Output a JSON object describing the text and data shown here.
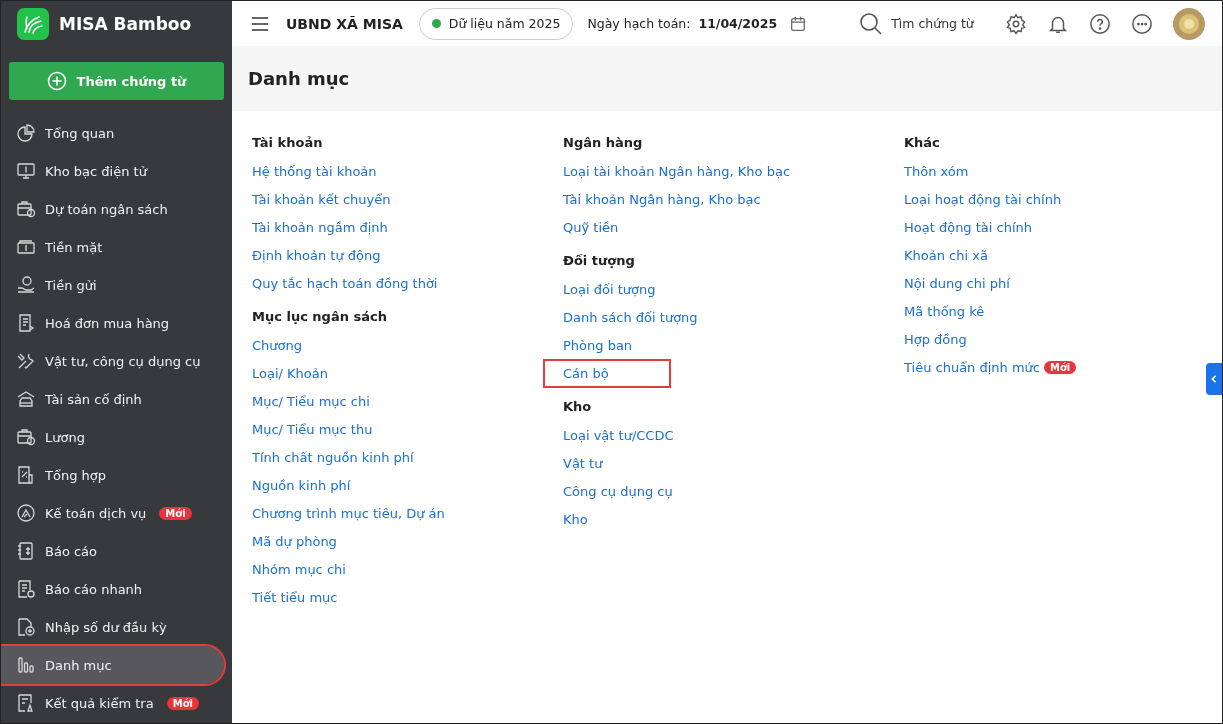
{
  "app": {
    "name": "MISA Bamboo",
    "add_button": "Thêm chứng từ"
  },
  "header": {
    "organization": "UBND XÃ MISA",
    "data_year": "Dữ liệu năm 2025",
    "posting_date_label": "Ngày hạch toán:",
    "posting_date": "11/04/2025",
    "search_placeholder": "Tìm chứng từ"
  },
  "sidebar": {
    "items": [
      {
        "label": "Tổng quan",
        "selected": false,
        "highlighted": false
      },
      {
        "label": "Kho bạc điện tử",
        "selected": false,
        "highlighted": false
      },
      {
        "label": "Dự toán ngân sách",
        "selected": false,
        "highlighted": false
      },
      {
        "label": "Tiền mặt",
        "selected": false,
        "highlighted": false
      },
      {
        "label": "Tiền gửi",
        "selected": false,
        "highlighted": false
      },
      {
        "label": "Hoá đơn mua hàng",
        "selected": false,
        "highlighted": false
      },
      {
        "label": "Vật tư, công cụ dụng cụ",
        "selected": false,
        "highlighted": false
      },
      {
        "label": "Tài sản cố định",
        "selected": false,
        "highlighted": false
      },
      {
        "label": "Lương",
        "selected": false,
        "highlighted": false
      },
      {
        "label": "Tổng hợp",
        "selected": false,
        "highlighted": false
      },
      {
        "label": "Kế toán dịch vụ",
        "selected": false,
        "highlighted": false,
        "badge": "Mới"
      },
      {
        "label": "Báo cáo",
        "selected": false,
        "highlighted": false
      },
      {
        "label": "Báo cáo nhanh",
        "selected": false,
        "highlighted": false
      },
      {
        "label": "Nhập số dư đầu kỳ",
        "selected": false,
        "highlighted": false
      },
      {
        "label": "Danh mục",
        "selected": true,
        "highlighted": true
      },
      {
        "label": "Kết quả kiểm tra",
        "selected": false,
        "highlighted": false,
        "badge": "Mới"
      }
    ]
  },
  "page": {
    "title": "Danh mục",
    "columns": [
      {
        "sections": [
          {
            "heading": "Tài khoản",
            "items": [
              {
                "label": "Hệ thống tài khoản",
                "highlighted": false
              },
              {
                "label": "Tài khoản kết chuyển",
                "highlighted": false
              },
              {
                "label": "Tài khoản ngầm định",
                "highlighted": false
              },
              {
                "label": "Định khoản tự động",
                "highlighted": false
              },
              {
                "label": "Quy tắc hạch toán đồng thời",
                "highlighted": false
              }
            ]
          },
          {
            "heading": "Mục lục ngân sách",
            "items": [
              {
                "label": "Chương",
                "highlighted": false
              },
              {
                "label": "Loại/ Khoản",
                "highlighted": false
              },
              {
                "label": "Mục/ Tiểu mục chi",
                "highlighted": false
              },
              {
                "label": "Mục/ Tiểu mục thu",
                "highlighted": false
              },
              {
                "label": "Tính chất nguồn kinh phí",
                "highlighted": false
              },
              {
                "label": "Nguồn kinh phí",
                "highlighted": false
              },
              {
                "label": "Chương trình mục tiêu, Dự án",
                "highlighted": false
              },
              {
                "label": "Mã dự phòng",
                "highlighted": false
              },
              {
                "label": "Nhóm mục chi",
                "highlighted": false
              },
              {
                "label": "Tiết tiểu mục",
                "highlighted": false
              }
            ]
          }
        ]
      },
      {
        "sections": [
          {
            "heading": "Ngân hàng",
            "items": [
              {
                "label": "Loại tài khoản Ngân hàng, Kho bạc",
                "highlighted": false
              },
              {
                "label": "Tài khoản Ngân hàng, Kho bạc",
                "highlighted": false
              },
              {
                "label": "Quỹ tiền",
                "highlighted": false
              }
            ]
          },
          {
            "heading": "Đối tượng",
            "items": [
              {
                "label": "Loại đối tượng",
                "highlighted": false
              },
              {
                "label": "Danh sách đối tượng",
                "highlighted": false
              },
              {
                "label": "Phòng ban",
                "highlighted": false
              },
              {
                "label": "Cán bộ",
                "highlighted": true
              }
            ]
          },
          {
            "heading": "Kho",
            "items": [
              {
                "label": "Loại vật tư/CCDC",
                "highlighted": false
              },
              {
                "label": "Vật tư",
                "highlighted": false
              },
              {
                "label": "Công cụ dụng cụ",
                "highlighted": false
              },
              {
                "label": "Kho",
                "highlighted": false
              }
            ]
          }
        ]
      },
      {
        "sections": [
          {
            "heading": "Khác",
            "items": [
              {
                "label": "Thôn xóm",
                "highlighted": false
              },
              {
                "label": "Loại hoạt động tài chính",
                "highlighted": false
              },
              {
                "label": "Hoạt động tài chính",
                "highlighted": false
              },
              {
                "label": "Khoản chi xã",
                "highlighted": false
              },
              {
                "label": "Nội dung chi phí",
                "highlighted": false
              },
              {
                "label": "Mã thống kê",
                "highlighted": false
              },
              {
                "label": "Hợp đồng",
                "highlighted": false
              },
              {
                "label": "Tiêu chuẩn định mức",
                "highlighted": false,
                "badge": "Mới"
              }
            ]
          }
        ]
      }
    ]
  }
}
